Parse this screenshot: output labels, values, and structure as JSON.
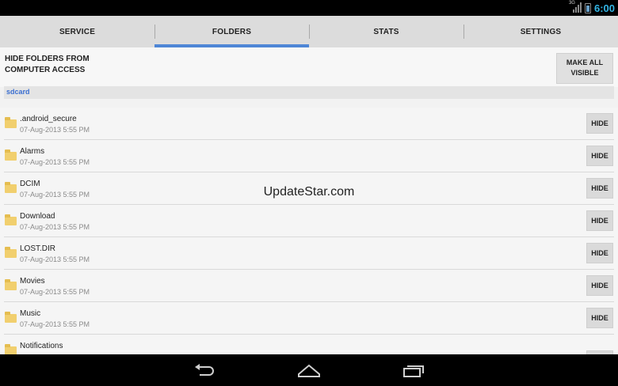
{
  "status": {
    "time": "6:00",
    "network": "3G"
  },
  "tabs": [
    {
      "label": "SERVICE",
      "active": false
    },
    {
      "label": "FOLDERS",
      "active": true
    },
    {
      "label": "STATS",
      "active": false
    },
    {
      "label": "SETTINGS",
      "active": false
    }
  ],
  "header": {
    "title_line1": "HIDE FOLDERS FROM",
    "title_line2": "COMPUTER ACCESS",
    "make_visible_line1": "MAKE ALL",
    "make_visible_line2": "VISIBLE"
  },
  "path": "sdcard",
  "hide_label": "HIDE",
  "folders": [
    {
      "name": ".android_secure",
      "date": "07-Aug-2013 5:55 PM"
    },
    {
      "name": "Alarms",
      "date": "07-Aug-2013 5:55 PM"
    },
    {
      "name": "DCIM",
      "date": "07-Aug-2013 5:55 PM"
    },
    {
      "name": "Download",
      "date": "07-Aug-2013 5:55 PM"
    },
    {
      "name": "LOST.DIR",
      "date": "07-Aug-2013 5:55 PM"
    },
    {
      "name": "Movies",
      "date": "07-Aug-2013 5:55 PM"
    },
    {
      "name": "Music",
      "date": "07-Aug-2013 5:55 PM"
    },
    {
      "name": "Notifications",
      "date": ""
    }
  ],
  "watermark": "UpdateStar.com",
  "colors": {
    "accent": "#4e86d6",
    "path_text": "#3b6fd1",
    "clock": "#33b5e5",
    "folder": "#f1cf6e"
  },
  "icons": {
    "back": "back-arrow-icon",
    "home": "home-icon",
    "recents": "recent-apps-icon",
    "folder": "folder-icon"
  }
}
